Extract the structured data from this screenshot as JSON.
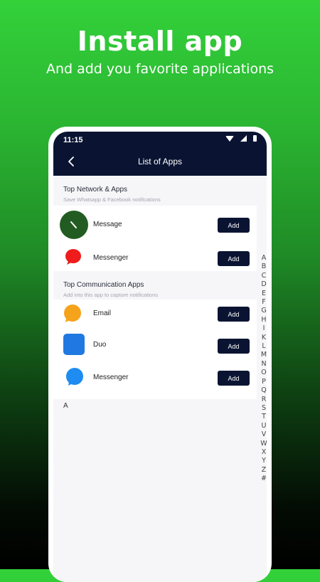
{
  "promo": {
    "title": "Install app",
    "subtitle": "And add you favorite applications"
  },
  "status_bar": {
    "time": "11:15"
  },
  "app_bar": {
    "title": "List of Apps"
  },
  "sections": [
    {
      "title": "Top Network & Apps",
      "subtitle": "Save Whatsapp & Facebook notifications",
      "apps": [
        {
          "name": "Message",
          "icon": "message-icon",
          "button": "Add"
        },
        {
          "name": "Messenger",
          "icon": "messenger-icon",
          "button": "Add"
        }
      ]
    },
    {
      "title": "Top Communication Apps",
      "subtitle": "Add into this app to capture notifications",
      "apps": [
        {
          "name": "Email",
          "icon": "email-icon",
          "button": "Add"
        },
        {
          "name": "Duo",
          "icon": "duo-icon",
          "button": "Add"
        },
        {
          "name": "Messenger",
          "icon": "messenger-icon",
          "button": "Add"
        }
      ]
    }
  ],
  "list_header": "A",
  "index_letters": [
    "A",
    "B",
    "C",
    "D",
    "E",
    "F",
    "G",
    "H",
    "I",
    "K",
    "L",
    "M",
    "N",
    "O",
    "P",
    "Q",
    "R",
    "S",
    "T",
    "U",
    "V",
    "W",
    "X",
    "Y",
    "Z",
    "#"
  ],
  "colors": {
    "background_top": "#33d13a",
    "app_bar": "#0a1432",
    "button": "#0a1432",
    "message_icon": "#235c22",
    "messenger_red": "#ee1c1c",
    "email_orange": "#f5a31a",
    "duo_blue": "#1f79e0",
    "messenger_blue": "#1e8cf0"
  }
}
